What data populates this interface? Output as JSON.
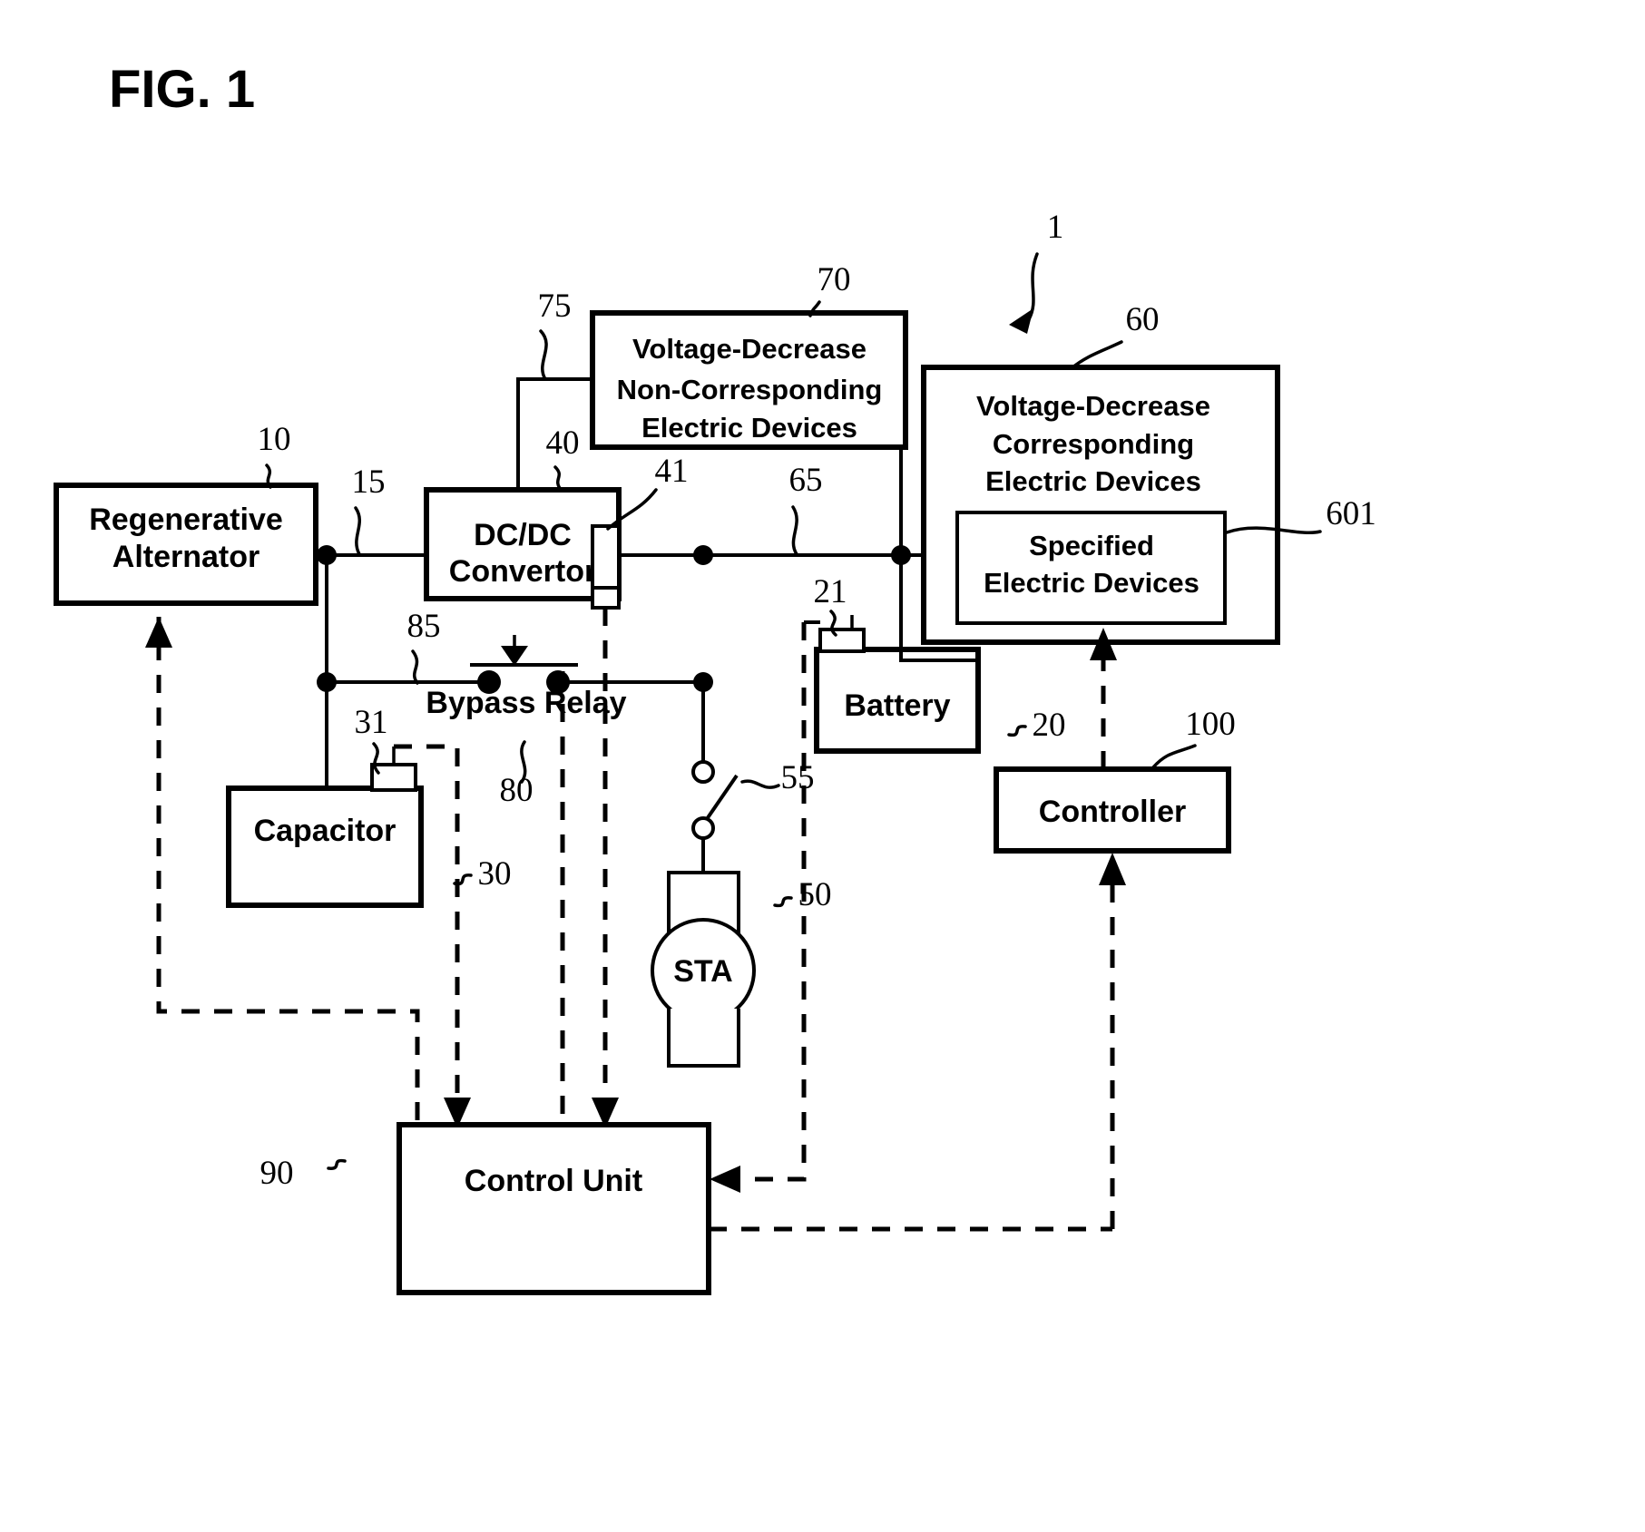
{
  "figure": {
    "title": "FIG. 1",
    "system_ref": "1"
  },
  "blocks": [
    {
      "id": "regenerative-alternator",
      "lines": [
        "Regenerative",
        "Alternator"
      ],
      "ref": "10"
    },
    {
      "id": "dcdc-convertor",
      "lines": [
        "DC/DC",
        "Convertor"
      ],
      "ref": "40"
    },
    {
      "id": "voltage-decrease-non-corresponding",
      "lines": [
        "Voltage-Decrease",
        "Non-Corresponding",
        "Electric Devices"
      ],
      "ref": "70"
    },
    {
      "id": "voltage-decrease-corresponding",
      "lines": [
        "Voltage-Decrease",
        "Corresponding",
        "Electric Devices"
      ],
      "ref": "60"
    },
    {
      "id": "specified-electric-devices",
      "lines": [
        "Specified",
        "Electric Devices"
      ],
      "ref": "601"
    },
    {
      "id": "capacitor",
      "lines": [
        "Capacitor"
      ],
      "ref": "30"
    },
    {
      "id": "battery",
      "lines": [
        "Battery"
      ],
      "ref": "20"
    },
    {
      "id": "controller",
      "lines": [
        "Controller"
      ],
      "ref": "100"
    },
    {
      "id": "control-unit",
      "lines": [
        "Control Unit"
      ],
      "ref": "90"
    },
    {
      "id": "starter-motor",
      "lines": [
        "STA"
      ],
      "ref": "50"
    },
    {
      "id": "bypass-relay",
      "lines": [
        "Bypass Relay"
      ],
      "ref": "80"
    }
  ],
  "labels": {
    "regenerative_alternator_l1": "Regenerative",
    "regenerative_alternator_l2": "Alternator",
    "dcdc_l1": "DC/DC",
    "dcdc_l2": "Convertor",
    "vd_non_corr_l1": "Voltage-Decrease",
    "vd_non_corr_l2": "Non-Corresponding",
    "vd_non_corr_l3": "Electric Devices",
    "vd_corr_l1": "Voltage-Decrease",
    "vd_corr_l2": "Corresponding",
    "vd_corr_l3": "Electric Devices",
    "specified_l1": "Specified",
    "specified_l2": "Electric Devices",
    "capacitor": "Capacitor",
    "battery": "Battery",
    "controller": "Controller",
    "control_unit": "Control Unit",
    "sta": "STA",
    "bypass_relay": "Bypass Relay"
  },
  "reference_numerals": {
    "system": "1",
    "alternator": "10",
    "alternator_line": "15",
    "battery": "20",
    "battery_terminal": "21",
    "capacitor": "30",
    "capacitor_terminal": "31",
    "dcdc": "40",
    "dcdc_switch": "41",
    "starter": "50",
    "starter_switch": "55",
    "vd_corresponding": "60",
    "specified_devices": "601",
    "bus_65": "65",
    "vd_non_corresponding": "70",
    "line_75": "75",
    "bypass_relay": "80",
    "bypass_line": "85",
    "control_unit": "90",
    "controller": "100"
  },
  "colors": {
    "line": "#000000",
    "background": "#ffffff",
    "text": "#000000"
  }
}
